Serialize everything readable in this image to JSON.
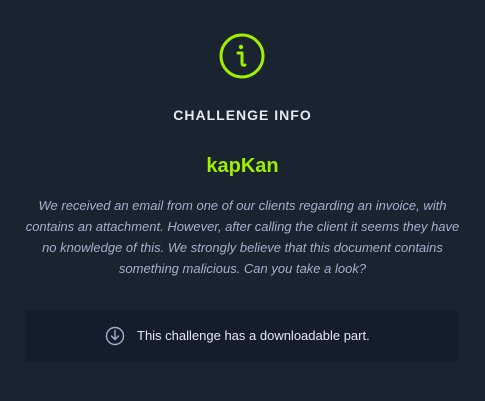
{
  "header": {
    "icon": "info-icon",
    "title": "CHALLENGE INFO"
  },
  "challenge": {
    "name": "kapKan",
    "description": "We received an email from one of our clients regarding an invoice, with contains an attachment. However, after calling the client it seems they have no knowledge of this. We strongly believe that this document contains something malicious. Can you take a look?"
  },
  "download": {
    "icon": "download-icon",
    "text": "This challenge has a downloadable part."
  },
  "colors": {
    "background": "#1a2330",
    "panel": "#141d2b",
    "accent": "#9fef00",
    "text": "#a4b1cd",
    "heading": "#e3e8f1"
  }
}
